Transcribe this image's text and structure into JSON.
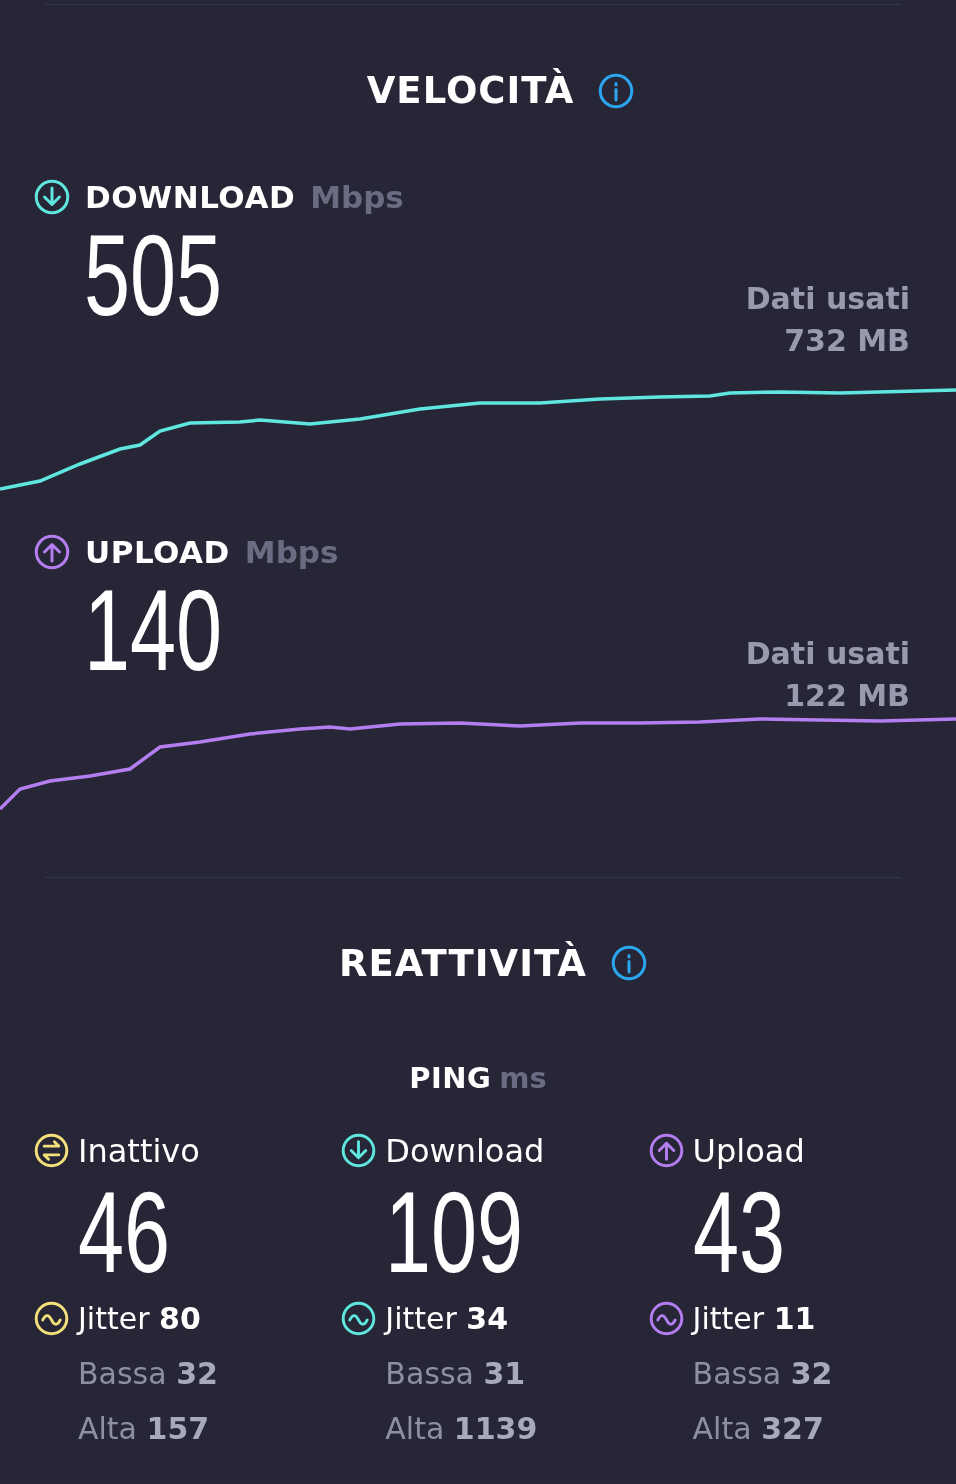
{
  "speed": {
    "title": "VELOCITÀ",
    "tests": [
      {
        "kind": "download",
        "label": "DOWNLOAD",
        "unit": "Mbps",
        "value": "505",
        "data_label": "Dati usati",
        "data_value": "732 MB",
        "color": "#5ee6df"
      },
      {
        "kind": "upload",
        "label": "UPLOAD",
        "unit": "Mbps",
        "value": "140",
        "data_label": "Dati usati",
        "data_value": "122 MB",
        "color": "#b47ef0"
      }
    ]
  },
  "responsiveness": {
    "title": "REATTIVITÀ",
    "ping_label": "PING",
    "ping_unit": "ms",
    "columns": [
      {
        "kind": "idle",
        "label": "Inattivo",
        "value": "46",
        "jitter": "Jitter **80**",
        "low": "Bassa **32**",
        "high": "Alta **157**",
        "color": "#f3e07a"
      },
      {
        "kind": "download",
        "label": "Download",
        "value": "109",
        "jitter": "Jitter **34**",
        "low": "Bassa **31**",
        "high": "Alta **1139**",
        "color": "#5ee6df"
      },
      {
        "kind": "upload",
        "label": "Upload",
        "value": "43",
        "jitter": "Jitter **11**",
        "low": "Bassa **32**",
        "high": "Alta **327**",
        "color": "#b47ef0"
      }
    ]
  }
}
